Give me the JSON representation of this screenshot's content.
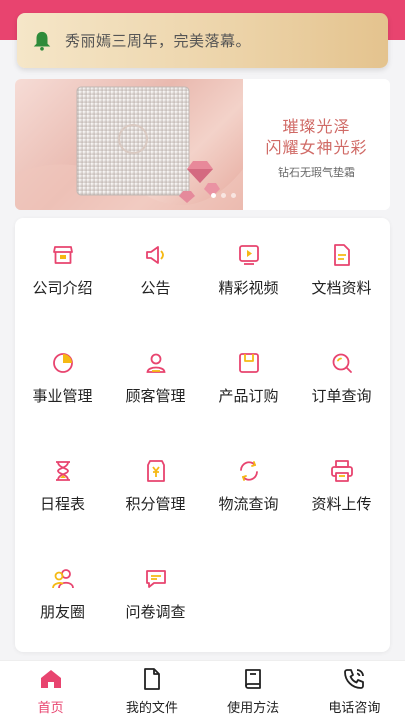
{
  "notice": {
    "text": "秀丽嫣三周年，完美落幕。"
  },
  "banner": {
    "slogan_line1": "璀璨光泽",
    "slogan_line2": "闪耀女神光彩",
    "slogan_line3": "钻石无瑕气垫霜"
  },
  "grid": {
    "items": [
      {
        "label": "公司介绍",
        "icon": "shop-icon"
      },
      {
        "label": "公告",
        "icon": "megaphone-icon"
      },
      {
        "label": "精彩视频",
        "icon": "video-icon"
      },
      {
        "label": "文档资料",
        "icon": "document-icon"
      },
      {
        "label": "事业管理",
        "icon": "pie-chart-icon"
      },
      {
        "label": "顾客管理",
        "icon": "person-icon"
      },
      {
        "label": "产品订购",
        "icon": "box-icon"
      },
      {
        "label": "订单查询",
        "icon": "search-icon"
      },
      {
        "label": "日程表",
        "icon": "hourglass-icon"
      },
      {
        "label": "积分管理",
        "icon": "points-icon"
      },
      {
        "label": "物流查询",
        "icon": "refresh-icon"
      },
      {
        "label": "资料上传",
        "icon": "printer-icon"
      },
      {
        "label": "朋友圈",
        "icon": "friends-icon"
      },
      {
        "label": "问卷调查",
        "icon": "chat-icon"
      }
    ]
  },
  "tabbar": {
    "items": [
      {
        "label": "首页",
        "icon": "home-icon",
        "active": true
      },
      {
        "label": "我的文件",
        "icon": "file-icon",
        "active": false
      },
      {
        "label": "使用方法",
        "icon": "book-icon",
        "active": false
      },
      {
        "label": "电话咨询",
        "icon": "phone-icon",
        "active": false
      }
    ]
  },
  "colors": {
    "brand": "#e8446f",
    "icon_pink": "#e8446f",
    "icon_yellow": "#f5b914",
    "notice_gold": "#ecd3a8",
    "bell_green": "#2e8b3a"
  }
}
